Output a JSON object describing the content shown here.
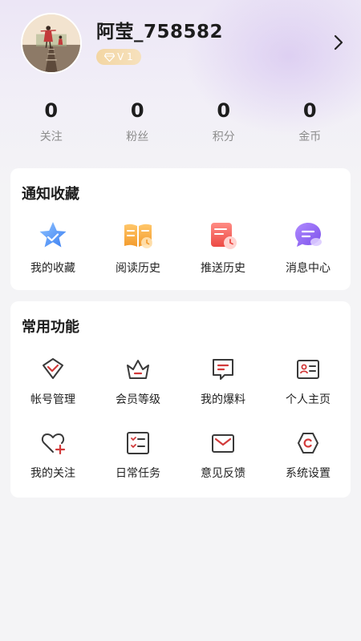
{
  "profile": {
    "username": "阿莹_758582",
    "level": "V 1"
  },
  "stats": [
    {
      "value": "0",
      "label": "关注"
    },
    {
      "value": "0",
      "label": "粉丝"
    },
    {
      "value": "0",
      "label": "积分"
    },
    {
      "value": "0",
      "label": "金币"
    }
  ],
  "notify_section": {
    "title": "通知收藏",
    "items": [
      {
        "label": "我的收藏",
        "icon": "star-icon"
      },
      {
        "label": "阅读历史",
        "icon": "book-icon"
      },
      {
        "label": "推送历史",
        "icon": "push-history-icon"
      },
      {
        "label": "消息中心",
        "icon": "message-icon"
      }
    ]
  },
  "functions_section": {
    "title": "常用功能",
    "items": [
      {
        "label": "帐号管理",
        "icon": "account-icon"
      },
      {
        "label": "会员等级",
        "icon": "crown-icon"
      },
      {
        "label": "我的爆料",
        "icon": "report-icon"
      },
      {
        "label": "个人主页",
        "icon": "profile-card-icon"
      },
      {
        "label": "我的关注",
        "icon": "heart-plus-icon"
      },
      {
        "label": "日常任务",
        "icon": "task-list-icon"
      },
      {
        "label": "意见反馈",
        "icon": "mail-icon"
      },
      {
        "label": "系统设置",
        "icon": "settings-icon"
      }
    ]
  },
  "colors": {
    "accent": "#d23a3a",
    "badge": "#f3d6a3"
  }
}
